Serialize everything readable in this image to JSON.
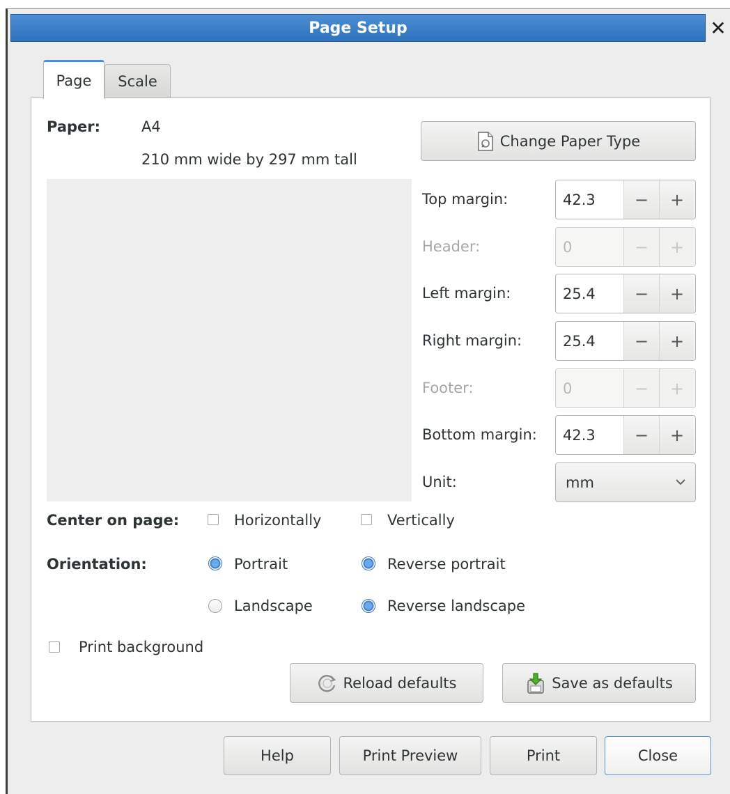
{
  "window": {
    "title": "Page Setup",
    "close_glyph": "✕"
  },
  "tabs": [
    {
      "label": "Page",
      "active": true
    },
    {
      "label": "Scale",
      "active": false
    }
  ],
  "paper": {
    "label": "Paper:",
    "name": "A4",
    "dimensions": "210 mm wide by 297 mm tall",
    "change_button": "Change Paper Type"
  },
  "margins": {
    "top": {
      "label": "Top margin:",
      "value": "42.3",
      "enabled": true
    },
    "header": {
      "label": "Header:",
      "value": "0",
      "enabled": false
    },
    "left": {
      "label": "Left margin:",
      "value": "25.4",
      "enabled": true
    },
    "right": {
      "label": "Right margin:",
      "value": "25.4",
      "enabled": true
    },
    "footer": {
      "label": "Footer:",
      "value": "0",
      "enabled": false
    },
    "bottom": {
      "label": "Bottom margin:",
      "value": "42.3",
      "enabled": true
    },
    "minus_glyph": "−",
    "plus_glyph": "+"
  },
  "unit": {
    "label": "Unit:",
    "value": "mm"
  },
  "center": {
    "label": "Center on page:",
    "horizontally": {
      "label": "Horizontally",
      "checked": false
    },
    "vertically": {
      "label": "Vertically",
      "checked": false
    }
  },
  "orientation": {
    "label": "Orientation:",
    "portrait": {
      "label": "Portrait",
      "selected": true
    },
    "reverse_portrait": {
      "label": "Reverse portrait",
      "selected": true
    },
    "landscape": {
      "label": "Landscape",
      "selected": false
    },
    "reverse_landscape": {
      "label": "Reverse landscape",
      "selected": true
    }
  },
  "print_background": {
    "label": "Print background",
    "checked": false
  },
  "defaults": {
    "reload": "Reload defaults",
    "save": "Save as defaults"
  },
  "footer_buttons": {
    "help": "Help",
    "preview": "Print Preview",
    "print": "Print",
    "close": "Close"
  },
  "colors": {
    "titlebar": "#3a7fc8",
    "accent": "#4a90d9",
    "background": "#ededed"
  },
  "icons": {
    "change_paper": "paper-type-icon",
    "reload": "reload-icon",
    "save": "save-defaults-icon",
    "unit_dropdown": "chevron-down-icon"
  }
}
